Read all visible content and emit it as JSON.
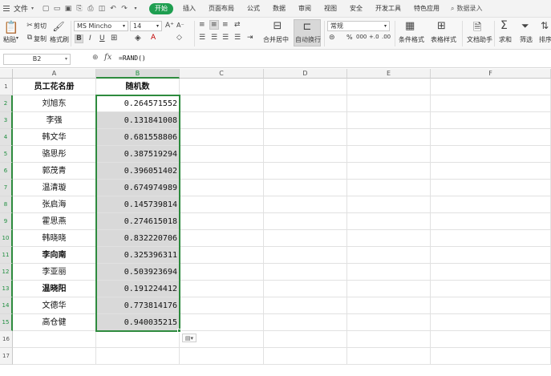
{
  "menubar": {
    "file_label": "文件",
    "tabs": [
      "开始",
      "插入",
      "页面布局",
      "公式",
      "数据",
      "审阅",
      "视图",
      "安全",
      "开发工具",
      "特色应用"
    ],
    "active_tab": "开始",
    "search_label": "数据录入"
  },
  "ribbon": {
    "paste": "粘贴",
    "cut": "剪切",
    "copy": "复制",
    "format_painter": "格式刷",
    "font_name": "MS Mincho",
    "font_size": "14",
    "merge_center": "合并居中",
    "auto_wrap": "自动换行",
    "number_format": "常规",
    "percent_label": "%",
    "thousands_label": "000",
    "decimal_inc": "+.0",
    "decimal_dec": ".00",
    "cond_format": "条件格式",
    "table_style": "表格样式",
    "doc_helper": "文档助手",
    "sum": "求和",
    "filter": "筛选",
    "sort": "排序"
  },
  "formula_bar": {
    "name_box": "B2",
    "fx_label": "fx",
    "formula": "=RAND()"
  },
  "grid": {
    "columns": [
      "A",
      "B",
      "C",
      "D",
      "E",
      "F"
    ],
    "selected_column": "B",
    "header_row": {
      "a": "员工花名册",
      "b": "随机数"
    },
    "rows": [
      {
        "num": "1",
        "a": "员工花名册",
        "b": "随机数"
      },
      {
        "num": "2",
        "a": "刘旭东",
        "b": "0.264571552"
      },
      {
        "num": "3",
        "a": "李强",
        "b": "0.131841008"
      },
      {
        "num": "4",
        "a": "韩文华",
        "b": "0.681558806"
      },
      {
        "num": "5",
        "a": "骆思彤",
        "b": "0.387519294"
      },
      {
        "num": "6",
        "a": "郭茂青",
        "b": "0.396051402"
      },
      {
        "num": "7",
        "a": "温清璇",
        "b": "0.674974989"
      },
      {
        "num": "8",
        "a": "张启海",
        "b": "0.145739814"
      },
      {
        "num": "9",
        "a": "霍思燕",
        "b": "0.274615018"
      },
      {
        "num": "10",
        "a": "韩晓晓",
        "b": "0.832220706"
      },
      {
        "num": "11",
        "a": "李向南",
        "b": "0.325396311"
      },
      {
        "num": "12",
        "a": "李亚丽",
        "b": "0.503923694"
      },
      {
        "num": "13",
        "a": "温晓阳",
        "b": "0.191224412"
      },
      {
        "num": "14",
        "a": "文德华",
        "b": "0.773814176"
      },
      {
        "num": "15",
        "a": "高仓健",
        "b": "0.940035215"
      },
      {
        "num": "16",
        "a": "",
        "b": ""
      },
      {
        "num": "17",
        "a": "",
        "b": ""
      }
    ]
  }
}
